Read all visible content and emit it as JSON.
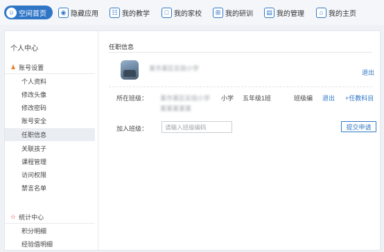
{
  "nav": {
    "items": [
      {
        "label": "空间首页",
        "icon": "user-icon"
      },
      {
        "label": "隐藏应用",
        "icon": "eye-icon"
      },
      {
        "label": "我的教学",
        "icon": "teach-icon"
      },
      {
        "label": "我的家校",
        "icon": "monitor-icon"
      },
      {
        "label": "我的研训",
        "icon": "grid-icon"
      },
      {
        "label": "我的管理",
        "icon": "document-icon"
      },
      {
        "label": "我的主页",
        "icon": "home-icon"
      }
    ]
  },
  "sidebar": {
    "title": "个人中心",
    "account_section": "账号设置",
    "account_items": [
      "个人资料",
      "修改头像",
      "修改密码",
      "账号安全",
      "任职信息",
      "关联孩子",
      "课程管理",
      "访问权限",
      "禁言名单"
    ],
    "active_item": "任职信息",
    "stats_section": "统计中心",
    "stats_items": [
      "积分明细",
      "经验值明细"
    ]
  },
  "content": {
    "section_title": "任职信息",
    "school_name_blurred": "某市某区实验小学",
    "quit_top": "退出",
    "class_label": "所在班级：",
    "class_school_blurred": "某市某区实验小学",
    "class_school_blurred_line2": "某某某某某",
    "grade_type": "小学",
    "class_name": "五年级1班",
    "class_role": "班级编",
    "quit_class": "退出",
    "add_subject": "+任教科目",
    "join_label": "加入班级：",
    "join_placeholder": "请输入班级编码",
    "submit_label": "提交申请"
  },
  "colors": {
    "accent": "#2f76c6",
    "account_icon": "#e6862a",
    "stats_icon": "#d9302c"
  }
}
